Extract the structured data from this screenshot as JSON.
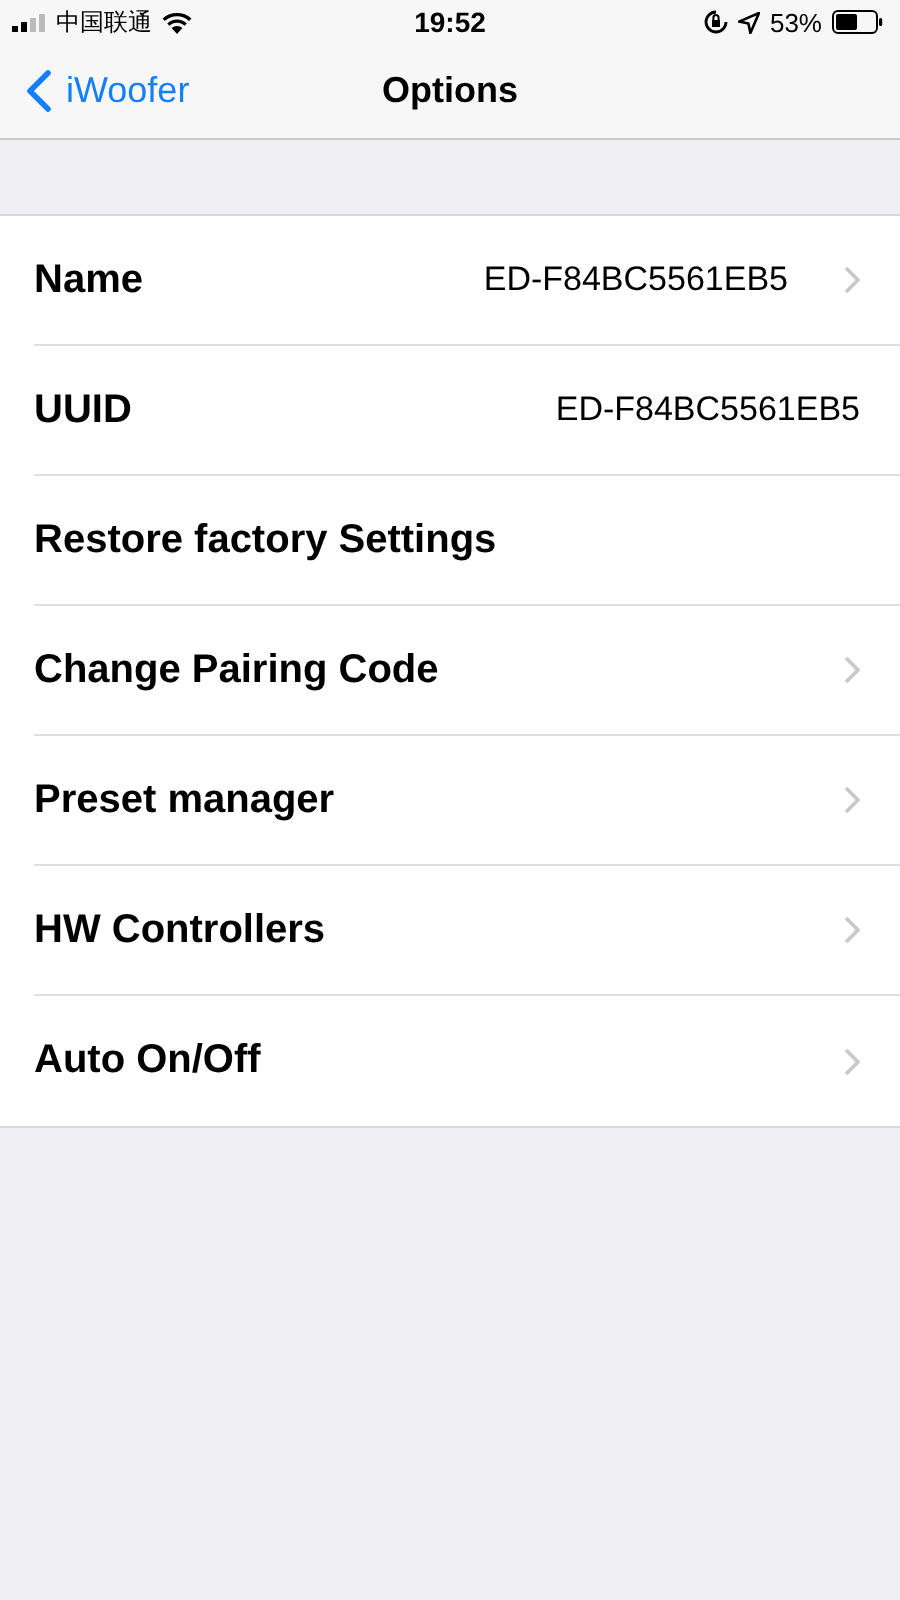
{
  "status_bar": {
    "carrier": "中国联通",
    "time": "19:52",
    "battery": "53%"
  },
  "nav": {
    "back": "iWoofer",
    "title": "Options"
  },
  "rows": [
    {
      "label": "Name",
      "value": "ED-F84BC5561EB5",
      "disclosure": true
    },
    {
      "label": "UUID",
      "value": "ED-F84BC5561EB5",
      "disclosure": false
    },
    {
      "label": "Restore factory Settings",
      "disclosure": false
    },
    {
      "label": "Change Pairing Code",
      "disclosure": true
    },
    {
      "label": "Preset manager",
      "disclosure": true
    },
    {
      "label": "HW Controllers",
      "disclosure": true
    },
    {
      "label": "Auto On/Off",
      "disclosure": true
    }
  ]
}
